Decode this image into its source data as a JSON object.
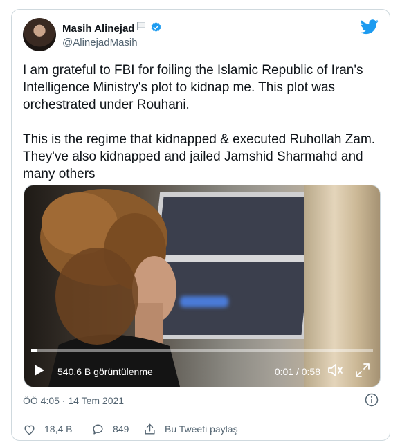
{
  "tweet": {
    "name": "Masih Alinejad",
    "handle": "@AlinejadMasih",
    "text": "I am grateful to FBI for foiling the Islamic Republic of Iran's Intelligence Ministry's plot to kidnap me. This plot was orchestrated under Rouhani.\n\nThis is the regime that kidnapped & executed Ruhollah Zam. They've also kidnapped and jailed Jamshid Sharmahd and many others",
    "timestamp": "ÖÖ 4:05 · 14 Tem 2021"
  },
  "video": {
    "views": "540,6 B görüntülenme",
    "time": "0:01 / 0:58",
    "progress": 0.017
  },
  "actions": {
    "likes": "18,4 B",
    "replies": "849",
    "share_label": "Bu Tweeti paylaş"
  },
  "colors": {
    "twitter_blue": "#1d9bf0",
    "secondary_text": "#536471",
    "border": "#cfd9de"
  },
  "icons": [
    "flag-icon",
    "verified-icon",
    "twitter-logo-icon",
    "play-icon",
    "volume-icon",
    "fullscreen-icon",
    "info-icon",
    "like-icon",
    "reply-icon",
    "share-icon"
  ]
}
